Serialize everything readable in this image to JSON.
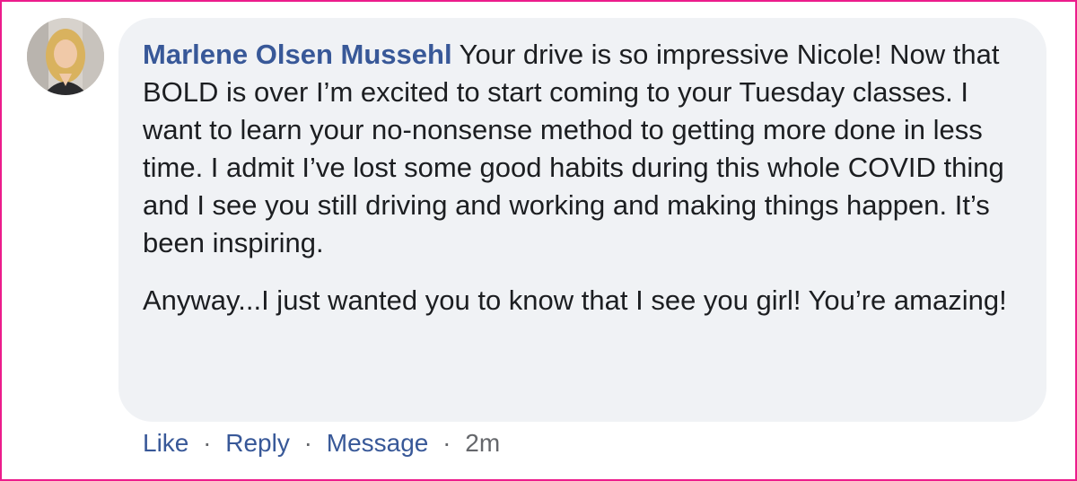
{
  "comment": {
    "author_name": "Marlene Olsen Mussehl",
    "first_paragraph": "Your drive is so impressive Nicole! Now that BOLD is over I’m excited to start coming to your Tuesday classes. I want to learn your no-nonsense method to getting more done in less time. I admit I’ve lost some good habits during this whole COVID thing and I see you still driving and working and making things happen. It’s been inspiring.",
    "second_paragraph": "Anyway...I just wanted you to know that I see you girl! You’re amazing!",
    "avatar_icon": "profile-photo"
  },
  "actions": {
    "like_label": "Like",
    "reply_label": "Reply",
    "message_label": "Message",
    "separator": "·",
    "timestamp": "2m"
  },
  "colors": {
    "frame_border": "#ec1c8c",
    "bubble_background": "#f0f2f5",
    "author_link": "#385898",
    "body_text": "#1c1e21",
    "meta_text": "#65676b"
  }
}
